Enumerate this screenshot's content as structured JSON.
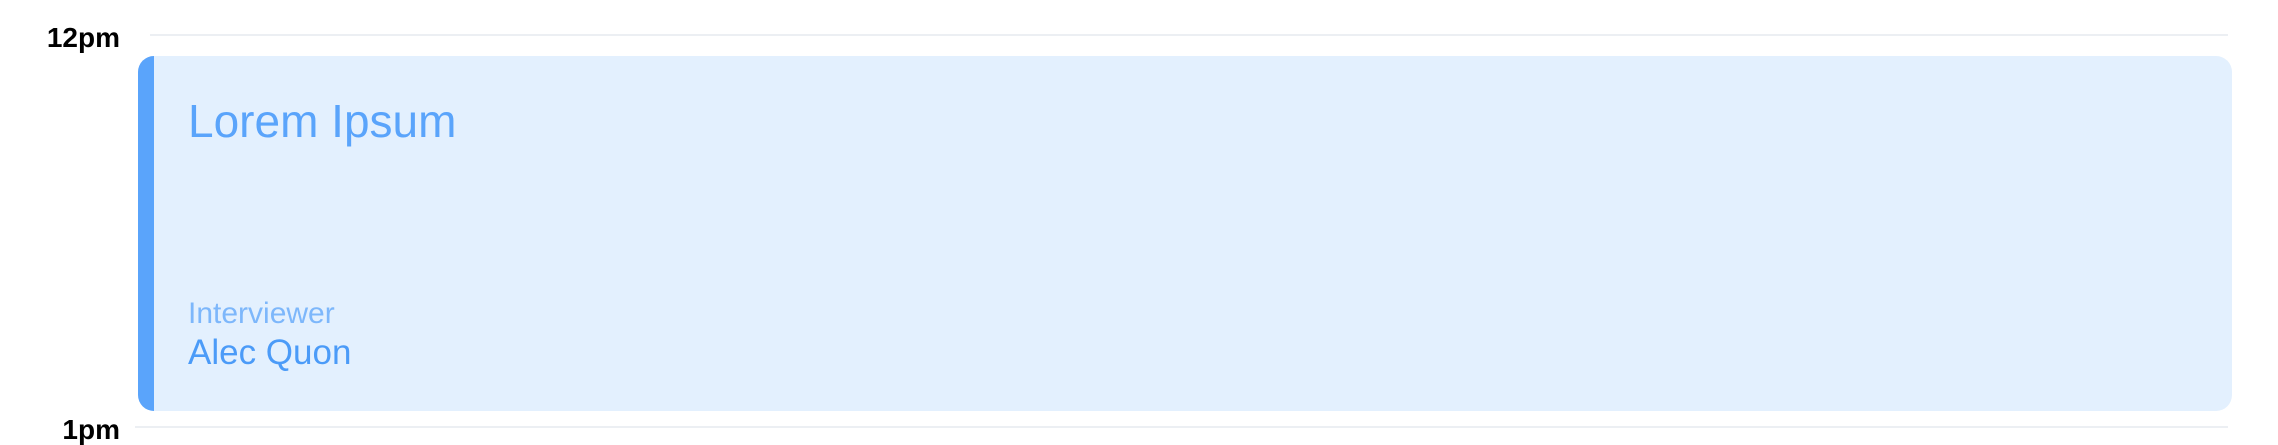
{
  "timeline": {
    "slots": [
      {
        "label": "12pm"
      },
      {
        "label": "1pm"
      }
    ]
  },
  "event": {
    "title": "Lorem Ipsum",
    "interviewer_label": "Interviewer",
    "interviewer_name": "Alec Quon",
    "colors": {
      "accent": "#5aa4fb",
      "background": "#e3f0fe",
      "text": "#5aa4fb"
    }
  }
}
